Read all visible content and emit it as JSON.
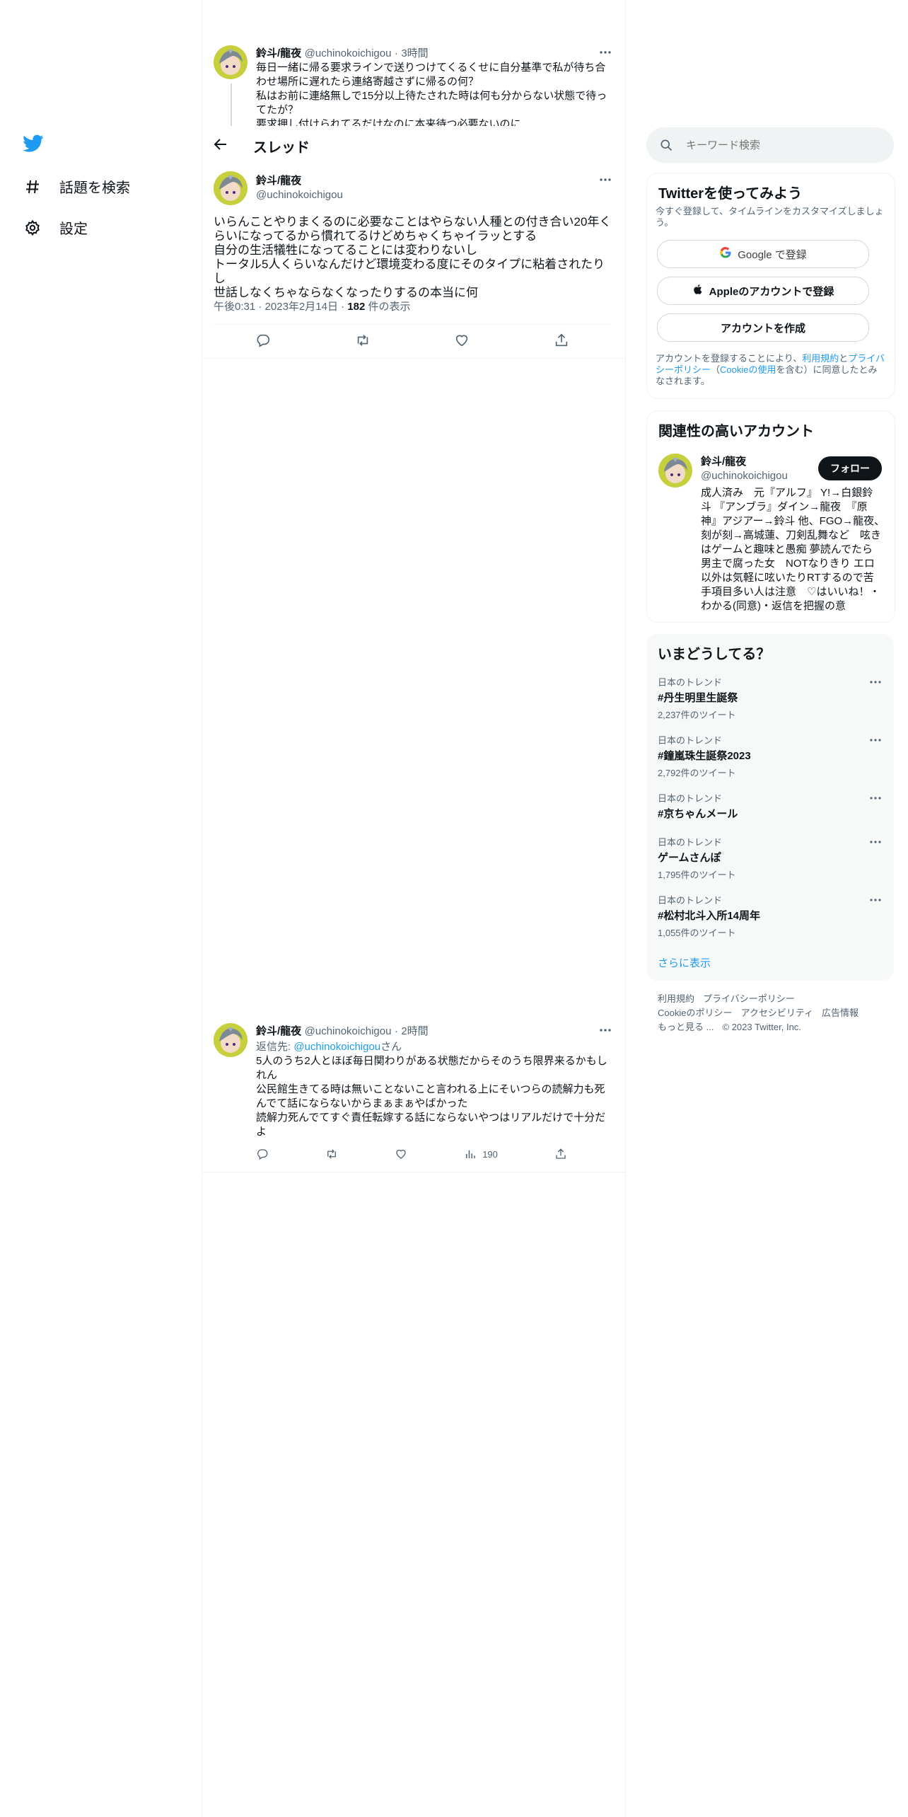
{
  "nav": {
    "explore_label": "話題を検索",
    "settings_label": "設定"
  },
  "prev_tweet": {
    "name": "鈴斗/龍夜",
    "handle": "@uchinokoichigou",
    "time": "3時間",
    "lines": [
      "毎日一緒に帰る要求ラインで送りつけてくるくせに自分基準で私が待ち合",
      "わせ場所に遅れたら連絡寄越さずに帰るの何？",
      "私はお前に連絡無しで15分以上待たされた時は何も分からない状態で待っ",
      "てたが？",
      "要求押し付けられてるだけなのに本来待つ必要ないのに"
    ]
  },
  "header": {
    "title": "スレッド"
  },
  "main_tweet": {
    "name": "鈴斗/龍夜",
    "handle": "@uchinokoichigou",
    "lines": [
      "いらんことやりまくるのに必要なことはやらない人種との付き合い20年く",
      "らいになってるから慣れてるけどめちゃくちゃイラッとする",
      "自分の生活犠牲になってることには変わりないし",
      "トータル5人くらいなんだけど環境変わる度にそのタイプに粘着されたりし",
      "世話しなくちゃならなくなったりするの本当に何"
    ],
    "time": "午後0:31",
    "date": "2023年2月14日",
    "views_count": "182",
    "views_label": "件の表示"
  },
  "reply_tweet": {
    "name": "鈴斗/龍夜",
    "handle": "@uchinokoichigou",
    "time": "2時間",
    "reply_prefix": "返信先: ",
    "reply_handle": "@uchinokoichigou",
    "reply_suffix": "さん",
    "lines": [
      "5人のうち2人とほぼ毎日関わりがある状態だからそのうち限界来るかもし",
      "れん",
      "公民館生きてる時は無いことないこと言われる上にそいつらの読解力も死",
      "んでて話にならないからまぁまぁやばかった",
      "読解力死んでてすぐ責任転嫁する話にならないやつはリアルだけで十分だ",
      "よ"
    ],
    "views": "190"
  },
  "search": {
    "placeholder": "キーワード検索"
  },
  "signup": {
    "title": "Twitterを使ってみよう",
    "subtitle": "今すぐ登録して、タイムラインをカスタマイズしましょう。",
    "google_label": "Google で登録",
    "apple_label": "Appleのアカウントで登録",
    "create_label": "アカウントを作成",
    "legal_1": "アカウントを登録することにより、",
    "legal_terms": "利用規約",
    "legal_and": "と",
    "legal_privacy": "プライバシーポリシー",
    "legal_paren_open": "（",
    "legal_cookie": "Cookieの使用",
    "legal_2": "を含む）に同意したとみなされます。"
  },
  "related": {
    "title": "関連性の高いアカウント",
    "name": "鈴斗/龍夜",
    "handle": "@uchinokoichigou",
    "follow_label": "フォロー",
    "bio_lines": [
      "成人済み　元『アルフ』 Y!→白銀鈴",
      "斗 『アンブラ』ダイン→龍夜　『原",
      "神』アジアー→鈴斗 他、FGO→龍夜、",
      "刻が刻→高城蓮、刀剣乱舞など　呟き",
      "はゲームと趣味と愚痴 夢読んでたら",
      "男主で腐った女　NOTなりきり エロ",
      "以外は気軽に呟いたりRTするので苦",
      "手項目多い人は注意　♡はいいね！・",
      "わかる(同意)・返信を把握の意"
    ]
  },
  "trends": {
    "title": "いまどうしてる？",
    "items": [
      {
        "category": "日本のトレンド",
        "title": "#丹生明里生誕祭",
        "count": "2,237件のツイート"
      },
      {
        "category": "日本のトレンド",
        "title": "#鐘嵐珠生誕祭2023",
        "count": "2,792件のツイート"
      },
      {
        "category": "日本のトレンド",
        "title": "#京ちゃんメール",
        "count": ""
      },
      {
        "category": "日本のトレンド",
        "title": "ゲームさんぽ",
        "count": "1,795件のツイート"
      },
      {
        "category": "日本のトレンド",
        "title": "#松村北斗入所14周年",
        "count": "1,055件のツイート"
      }
    ],
    "show_more": "さらに表示"
  },
  "footer": {
    "terms": "利用規約",
    "privacy": "プライバシーポリシー",
    "cookie": "Cookieのポリシー",
    "accessibility": "アクセシビリティ",
    "ads": "広告情報",
    "more": "もっと見る ...",
    "copyright": "© 2023 Twitter, Inc."
  },
  "colors": {
    "accent": "#1d9bf0",
    "text": "#0f1419",
    "muted": "#536471",
    "border": "#eff3f4"
  }
}
